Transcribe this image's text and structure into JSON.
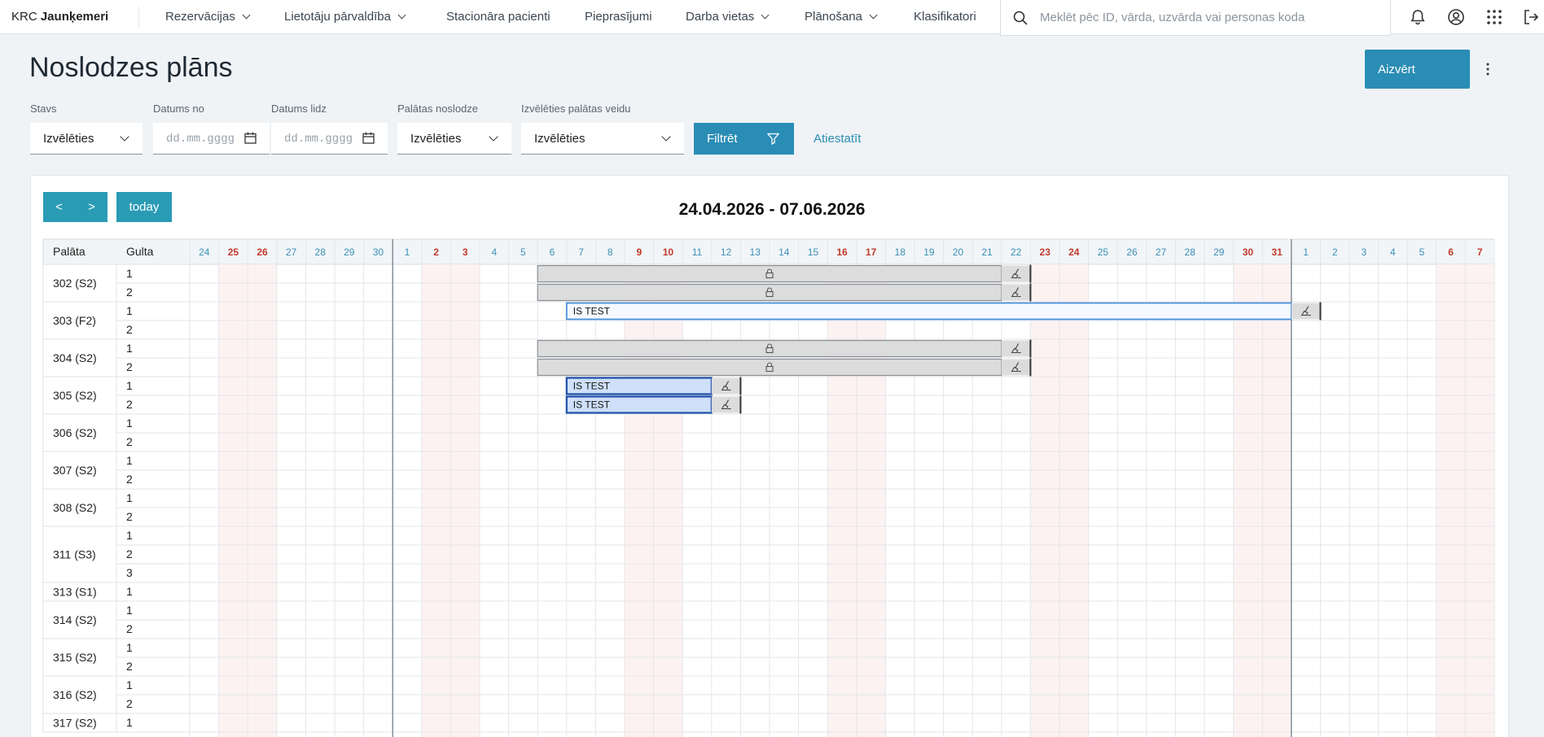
{
  "brand": {
    "prefix": "KRC ",
    "name": "Jaunķemeri"
  },
  "nav": [
    {
      "label": "Rezervācijas",
      "dropdown": true
    },
    {
      "label": "Lietotāju pārvaldība",
      "dropdown": true
    },
    {
      "label": "Stacionāra pacienti",
      "dropdown": false
    },
    {
      "label": "Pieprasījumi",
      "dropdown": false
    },
    {
      "label": "Darba vietas",
      "dropdown": true
    },
    {
      "label": "Plānošana",
      "dropdown": true
    },
    {
      "label": "Klasifikatori",
      "dropdown": false
    }
  ],
  "search": {
    "placeholder": "Meklēt pēc ID, vārda, uzvārda vai personas koda",
    "icon": "search-icon"
  },
  "top_icons": [
    "bell-icon",
    "user-circle-icon",
    "apps-grid-icon",
    "logout-icon"
  ],
  "page": {
    "title": "Noslodzes plāns",
    "close_label": "Aizvērt"
  },
  "filters": {
    "stavs": {
      "label": "Stavs",
      "value": "Izvēlēties"
    },
    "date_from": {
      "label": "Datums no",
      "placeholder": "dd.mm.gggg"
    },
    "date_to": {
      "label": "Datums lidz",
      "placeholder": "dd.mm.gggg"
    },
    "load": {
      "label": "Palātas noslodze",
      "value": "Izvēlēties"
    },
    "room_type": {
      "label": "Izvēlēties palātas veidu",
      "value": "Izvēlēties"
    },
    "filter_label": "Filtrēt",
    "reset_label": "Atiestatīt"
  },
  "calendar": {
    "prev": "<",
    "next": ">",
    "today": "today",
    "range": "24.04.2026 - 07.06.2026",
    "head_room": "Palāta",
    "head_bed": "Gulta",
    "days": [
      {
        "d": "24",
        "w": false
      },
      {
        "d": "25",
        "w": true
      },
      {
        "d": "26",
        "w": true
      },
      {
        "d": "27",
        "w": false
      },
      {
        "d": "28",
        "w": false
      },
      {
        "d": "29",
        "w": false
      },
      {
        "d": "30",
        "w": false
      },
      {
        "d": "1",
        "w": false
      },
      {
        "d": "2",
        "w": true
      },
      {
        "d": "3",
        "w": true
      },
      {
        "d": "4",
        "w": false
      },
      {
        "d": "5",
        "w": false
      },
      {
        "d": "6",
        "w": false
      },
      {
        "d": "7",
        "w": false
      },
      {
        "d": "8",
        "w": false
      },
      {
        "d": "9",
        "w": true
      },
      {
        "d": "10",
        "w": true
      },
      {
        "d": "11",
        "w": false
      },
      {
        "d": "12",
        "w": false
      },
      {
        "d": "13",
        "w": false
      },
      {
        "d": "14",
        "w": false
      },
      {
        "d": "15",
        "w": false
      },
      {
        "d": "16",
        "w": true
      },
      {
        "d": "17",
        "w": true
      },
      {
        "d": "18",
        "w": false
      },
      {
        "d": "19",
        "w": false
      },
      {
        "d": "20",
        "w": false
      },
      {
        "d": "21",
        "w": false
      },
      {
        "d": "22",
        "w": false
      },
      {
        "d": "23",
        "w": true
      },
      {
        "d": "24",
        "w": true
      },
      {
        "d": "25",
        "w": false
      },
      {
        "d": "26",
        "w": false
      },
      {
        "d": "27",
        "w": false
      },
      {
        "d": "28",
        "w": false
      },
      {
        "d": "29",
        "w": false
      },
      {
        "d": "30",
        "w": true
      },
      {
        "d": "31",
        "w": true
      },
      {
        "d": "1",
        "w": false
      },
      {
        "d": "2",
        "w": false
      },
      {
        "d": "3",
        "w": false
      },
      {
        "d": "4",
        "w": false
      },
      {
        "d": "5",
        "w": false
      },
      {
        "d": "6",
        "w": true
      },
      {
        "d": "7",
        "w": true
      }
    ],
    "month_starts": [
      7,
      38
    ],
    "rooms": [
      {
        "name": "302 (S2)",
        "beds": [
          "1",
          "2"
        ]
      },
      {
        "name": "303 (F2)",
        "beds": [
          "1",
          "2"
        ]
      },
      {
        "name": "304 (S2)",
        "beds": [
          "1",
          "2"
        ]
      },
      {
        "name": "305 (S2)",
        "beds": [
          "1",
          "2"
        ]
      },
      {
        "name": "306 (S2)",
        "beds": [
          "1",
          "2"
        ]
      },
      {
        "name": "307 (S2)",
        "beds": [
          "1",
          "2"
        ]
      },
      {
        "name": "308 (S2)",
        "beds": [
          "1",
          "2"
        ]
      },
      {
        "name": "311 (S3)",
        "beds": [
          "1",
          "2",
          "3"
        ]
      },
      {
        "name": "313 (S1)",
        "beds": [
          "1"
        ]
      },
      {
        "name": "314 (S2)",
        "beds": [
          "1",
          "2"
        ]
      },
      {
        "name": "315 (S2)",
        "beds": [
          "1",
          "2"
        ]
      },
      {
        "name": "316 (S2)",
        "beds": [
          "1",
          "2"
        ]
      },
      {
        "name": "317 (S2)",
        "beds": [
          "1"
        ]
      }
    ],
    "bookings": [
      {
        "row": 0,
        "start": 12,
        "end": 28,
        "type": "locked",
        "label": ""
      },
      {
        "row": 1,
        "start": 12,
        "end": 28,
        "type": "locked",
        "label": ""
      },
      {
        "row": 2,
        "start": 13,
        "end": 38,
        "type": "open",
        "label": "IS TEST"
      },
      {
        "row": 4,
        "start": 12,
        "end": 28,
        "type": "locked",
        "label": ""
      },
      {
        "row": 5,
        "start": 12,
        "end": 28,
        "type": "locked",
        "label": ""
      },
      {
        "row": 6,
        "start": 13,
        "end": 18,
        "type": "selected",
        "label": "IS TEST"
      },
      {
        "row": 7,
        "start": 13,
        "end": 18,
        "type": "selected",
        "label": "IS TEST"
      }
    ],
    "colors": {
      "weekday": "#3a8fb7",
      "weekend": "#c0392b",
      "accent": "#2a8db5"
    }
  }
}
